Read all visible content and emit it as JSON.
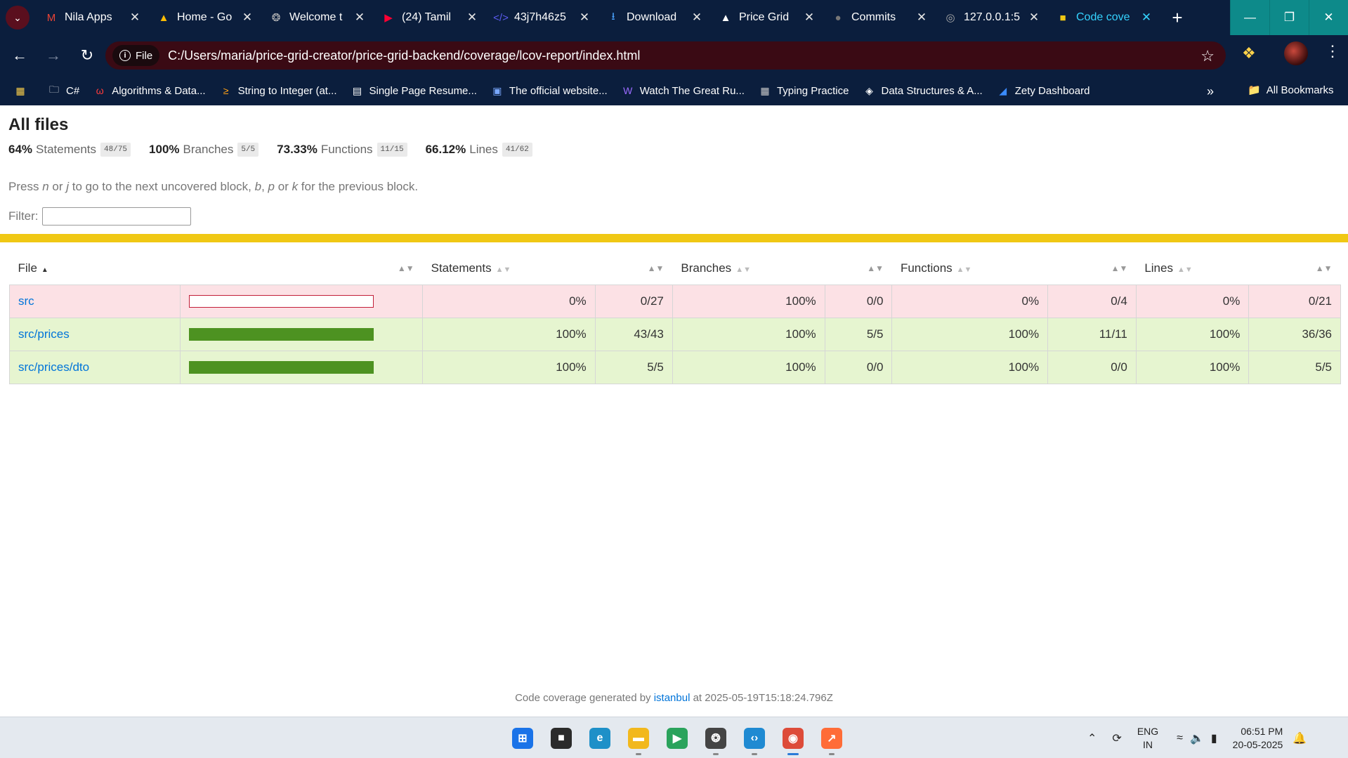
{
  "browser": {
    "tabs": [
      {
        "title": "Nila Apps",
        "icon": "gmail-icon",
        "color": "#ea4335"
      },
      {
        "title": "Home - Go",
        "icon": "drive-icon",
        "color": "#fbbc04"
      },
      {
        "title": "Welcome t",
        "icon": "openai-icon",
        "color": "#bbbbbb"
      },
      {
        "title": "(24) Tamil",
        "icon": "youtube-icon",
        "color": "#ff0033"
      },
      {
        "title": "43j7h46z5",
        "icon": "code-icon",
        "color": "#5b5bf0"
      },
      {
        "title": "Download",
        "icon": "download-icon",
        "color": "#4aa3ff"
      },
      {
        "title": "Price Grid",
        "icon": "triangle-icon",
        "color": "#ffffff"
      },
      {
        "title": "Commits",
        "icon": "github-icon",
        "color": "#777777"
      },
      {
        "title": "127.0.0.1:5",
        "icon": "globe-icon",
        "color": "#aaaaaa"
      },
      {
        "title": "Code cove",
        "icon": "coverage-icon",
        "color": "#f0c814",
        "active": true
      }
    ],
    "url_chip": "File",
    "url": "C:/Users/maria/price-grid-creator/price-grid-backend/coverage/lcov-report/index.html",
    "bookmarks": [
      {
        "label": "C#",
        "icon": "folder-icon"
      },
      {
        "label": "Algorithms & Data...",
        "icon": "algo-icon"
      },
      {
        "label": "String to Integer (at...",
        "icon": "leetcode-icon"
      },
      {
        "label": "Single Page Resume...",
        "icon": "doc-icon"
      },
      {
        "label": "The official website...",
        "icon": "site-icon"
      },
      {
        "label": "Watch The Great Ru...",
        "icon": "w-icon"
      },
      {
        "label": "Typing Practice",
        "icon": "typing-icon"
      },
      {
        "label": "Data Structures & A...",
        "icon": "ds-icon"
      },
      {
        "label": "Zety Dashboard",
        "icon": "zety-icon"
      }
    ],
    "all_bookmarks": "All Bookmarks"
  },
  "report": {
    "title": "All files",
    "summary": [
      {
        "pct": "64%",
        "label": "Statements",
        "frac": "48/75"
      },
      {
        "pct": "100%",
        "label": "Branches",
        "frac": "5/5"
      },
      {
        "pct": "73.33%",
        "label": "Functions",
        "frac": "11/15"
      },
      {
        "pct": "66.12%",
        "label": "Lines",
        "frac": "41/62"
      }
    ],
    "hint": {
      "p1": "Press ",
      "k1": "n",
      "p2": " or ",
      "k2": "j",
      "p3": " to go to the next uncovered block, ",
      "k3": "b",
      "p4": ", ",
      "k4": "p",
      "p5": " or ",
      "k5": "k",
      "p6": " for the previous block."
    },
    "filter_label": "Filter:",
    "columns": {
      "file": "File",
      "statements": "Statements",
      "branches": "Branches",
      "functions": "Functions",
      "lines": "Lines"
    },
    "rows": [
      {
        "file": "src",
        "coverage": 0,
        "status": "low",
        "st_pct": "0%",
        "st_frac": "0/27",
        "br_pct": "100%",
        "br_frac": "0/0",
        "fn_pct": "0%",
        "fn_frac": "0/4",
        "ln_pct": "0%",
        "ln_frac": "0/21"
      },
      {
        "file": "src/prices",
        "coverage": 1,
        "status": "high",
        "st_pct": "100%",
        "st_frac": "43/43",
        "br_pct": "100%",
        "br_frac": "5/5",
        "fn_pct": "100%",
        "fn_frac": "11/11",
        "ln_pct": "100%",
        "ln_frac": "36/36"
      },
      {
        "file": "src/prices/dto",
        "coverage": 1,
        "status": "high",
        "st_pct": "100%",
        "st_frac": "5/5",
        "br_pct": "100%",
        "br_frac": "0/0",
        "fn_pct": "100%",
        "fn_frac": "0/0",
        "ln_pct": "100%",
        "ln_frac": "5/5"
      }
    ],
    "footer": {
      "prefix": "Code coverage generated by ",
      "link": "istanbul",
      "suffix": " at 2025-05-19T15:18:24.796Z"
    }
  },
  "taskbar": {
    "apps": [
      {
        "name": "start-icon",
        "color": "#1a73e8",
        "active": false
      },
      {
        "name": "terminal-icon",
        "color": "#2b2b2b",
        "active": false
      },
      {
        "name": "edge-icon",
        "color": "#1e90c8",
        "active": false
      },
      {
        "name": "file-explorer-icon",
        "color": "#f2b81d",
        "active": false
      },
      {
        "name": "meet-icon",
        "color": "#2aa35c",
        "active": false
      },
      {
        "name": "chatgpt-icon",
        "color": "#444444",
        "active": false
      },
      {
        "name": "vscode-icon",
        "color": "#1f8ad2",
        "active": false
      },
      {
        "name": "chrome-icon",
        "color": "#dd4b39",
        "active": true
      },
      {
        "name": "postman-icon",
        "color": "#ff6c37",
        "active": false
      }
    ],
    "lang_1": "ENG",
    "lang_2": "IN",
    "time": "06:51 PM",
    "date": "20-05-2025"
  }
}
